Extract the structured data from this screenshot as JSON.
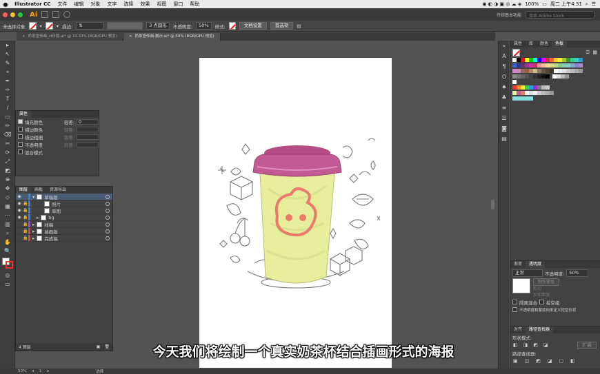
{
  "menubar": {
    "app_name": "Illustrator CC",
    "items": [
      "文件",
      "编辑",
      "对象",
      "文字",
      "选择",
      "效果",
      "视图",
      "窗口",
      "帮助"
    ],
    "battery": "100%",
    "clock": "周二 上午4:31"
  },
  "appbar": {
    "logo": "Ai",
    "workspace": "传统基本功能",
    "search_placeholder": "搜索 Adobe Stock"
  },
  "control_bar": {
    "selection_status": "未选择对象",
    "stroke_label": "描边:",
    "brush_label": "3 点圆形",
    "opacity_label": "不透明度:",
    "opacity_value": "50%",
    "style_label": "样式:",
    "doc_setup_button": "文档设置",
    "prefs_button": "首选项"
  },
  "doc_tabs": [
    {
      "label": "奶茶宣传画_cl日版.ai* @ 33.33% (RGB/GPU 预览)",
      "active": false
    },
    {
      "label": "奶茶宣传画-展示.ai* @ 50% (RGB/GPU 预览)",
      "active": true
    }
  ],
  "tools": [
    "▸",
    "↖",
    "✎",
    "⌖",
    "✒",
    "✑",
    "T",
    "/",
    "▭",
    "✏",
    "⌫",
    "✂",
    "⟳",
    "⤢",
    "◩",
    "⊕",
    "✥",
    "◇",
    "▦",
    "⋯",
    "▥",
    "⌕",
    "✋",
    "🔍"
  ],
  "appearance_panel": {
    "title": "属性",
    "rows": [
      {
        "label": "填充颜色",
        "checked": true,
        "extra_label": "容差:",
        "extra_value": "0"
      },
      {
        "label": "描边颜色",
        "checked": false,
        "extra_label": "容差:",
        "extra_value": ""
      },
      {
        "label": "描边粗细",
        "checked": false,
        "extra_label": "容差:",
        "extra_value": ""
      },
      {
        "label": "不透明度",
        "checked": false,
        "extra_label": "容差:",
        "extra_value": ""
      },
      {
        "label": "混合模式",
        "checked": false,
        "extra_label": "",
        "extra_value": ""
      }
    ]
  },
  "layers_panel": {
    "tabs": [
      "图层",
      "画板",
      "资源导出"
    ],
    "rows": [
      {
        "name": "草稿版",
        "indent": 0,
        "color": "#3f7fd4",
        "selected": true
      },
      {
        "name": "照片",
        "indent": 1,
        "color": "#3f7fd4",
        "selected": false
      },
      {
        "name": "草图",
        "indent": 1,
        "color": "#3f7fd4",
        "selected": false
      },
      {
        "name": "bg",
        "indent": 1,
        "color": "#3f7fd4",
        "selected": false
      },
      {
        "name": "线稿",
        "indent": 0,
        "color": "#b33fd4",
        "selected": false
      },
      {
        "name": "插画版",
        "indent": 0,
        "color": "#d44a3f",
        "selected": false
      },
      {
        "name": "完成稿",
        "indent": 0,
        "color": "#d44a3f",
        "selected": false
      }
    ],
    "footer": "4 图层"
  },
  "right_dock": {
    "swatch_tabs": [
      "属性",
      "库",
      "颜色",
      "色板"
    ],
    "transparency_tabs": [
      "渐变",
      "透明度"
    ],
    "blend_mode": "正常",
    "opacity_label": "不透明度:",
    "opacity_value": "50%",
    "make_mask_button": "制作蒙版",
    "clip_label": "剪切",
    "invert_mask_label": "反相蒙版",
    "isolate_blend": "隔离混合",
    "knockout_group": "挖空组",
    "opacity_mask_define": "不透明度和蒙版用来定义挖空形状",
    "pathfinder_tabs": [
      "对齐",
      "路径查找器"
    ],
    "shape_modes_label": "形状模式:",
    "expand_button": "扩展",
    "pathfinders_label": "路径查找器:"
  },
  "subtitle": "今天我们将绘制一个真实奶茶杯结合插画形式的海报",
  "status_bar": {
    "zoom": "50%",
    "page": "1",
    "tool_name": "选择"
  },
  "colors": {
    "cup_yellow": "#e6ee9c",
    "lid_pink": "#c25a93",
    "logo_red": "#ea7a6a"
  }
}
